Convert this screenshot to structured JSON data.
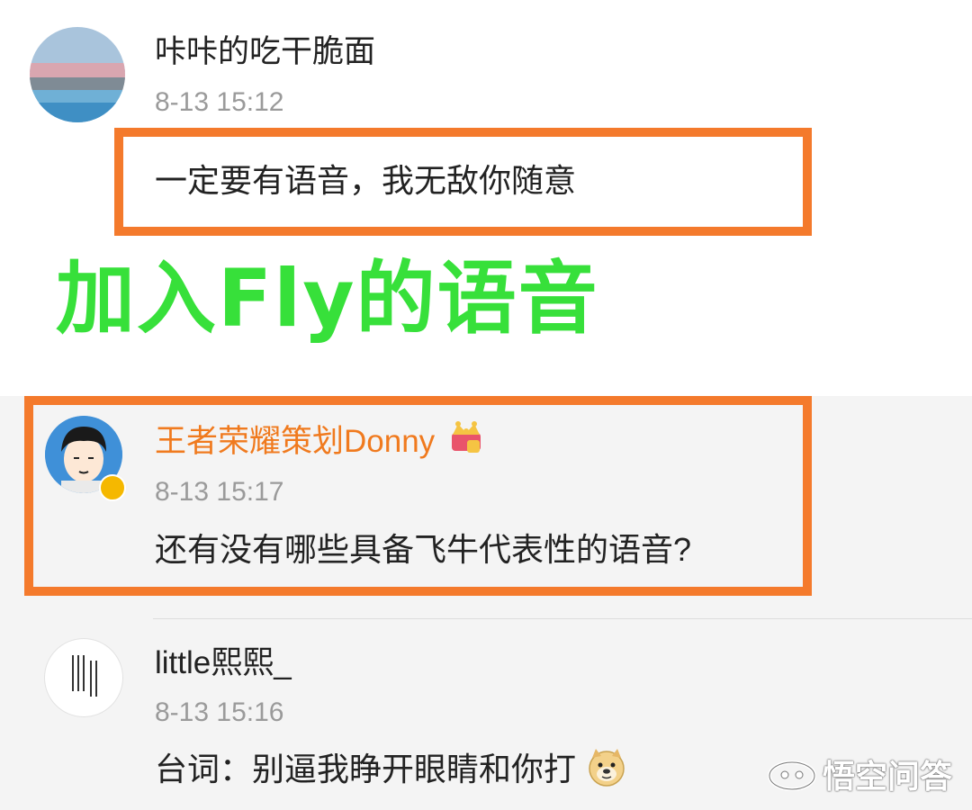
{
  "comments": [
    {
      "username": "咔咔的吃干脆面",
      "time": "8-13 15:12",
      "text": "一定要有语音，我无敌你随意",
      "avatar": "landscape-avatar"
    },
    {
      "username": "王者荣耀策划Donny",
      "time": "8-13 15:17",
      "text": "还有没有哪些具备飞牛代表性的语音?",
      "avatar": "cartoon-boy-avatar",
      "badges": [
        "crown-icon",
        "verified-icon"
      ]
    },
    {
      "username": "little熙熙_",
      "time": "8-13 15:16",
      "text": "台词：别逼我睁开眼睛和你打",
      "avatar": "calligraphy-avatar",
      "emoji": "doge-emoji-icon"
    }
  ],
  "overlay_caption": "加入Fly的语音",
  "watermark": {
    "text": "悟空问答",
    "icon": "wukong-logo-icon"
  },
  "colors": {
    "highlight_orange": "#f47a2c",
    "caption_green": "#37e03a",
    "vip_name_orange": "#f07a1e",
    "time_gray": "#9a9a9a",
    "lower_background": "#f4f4f4"
  }
}
